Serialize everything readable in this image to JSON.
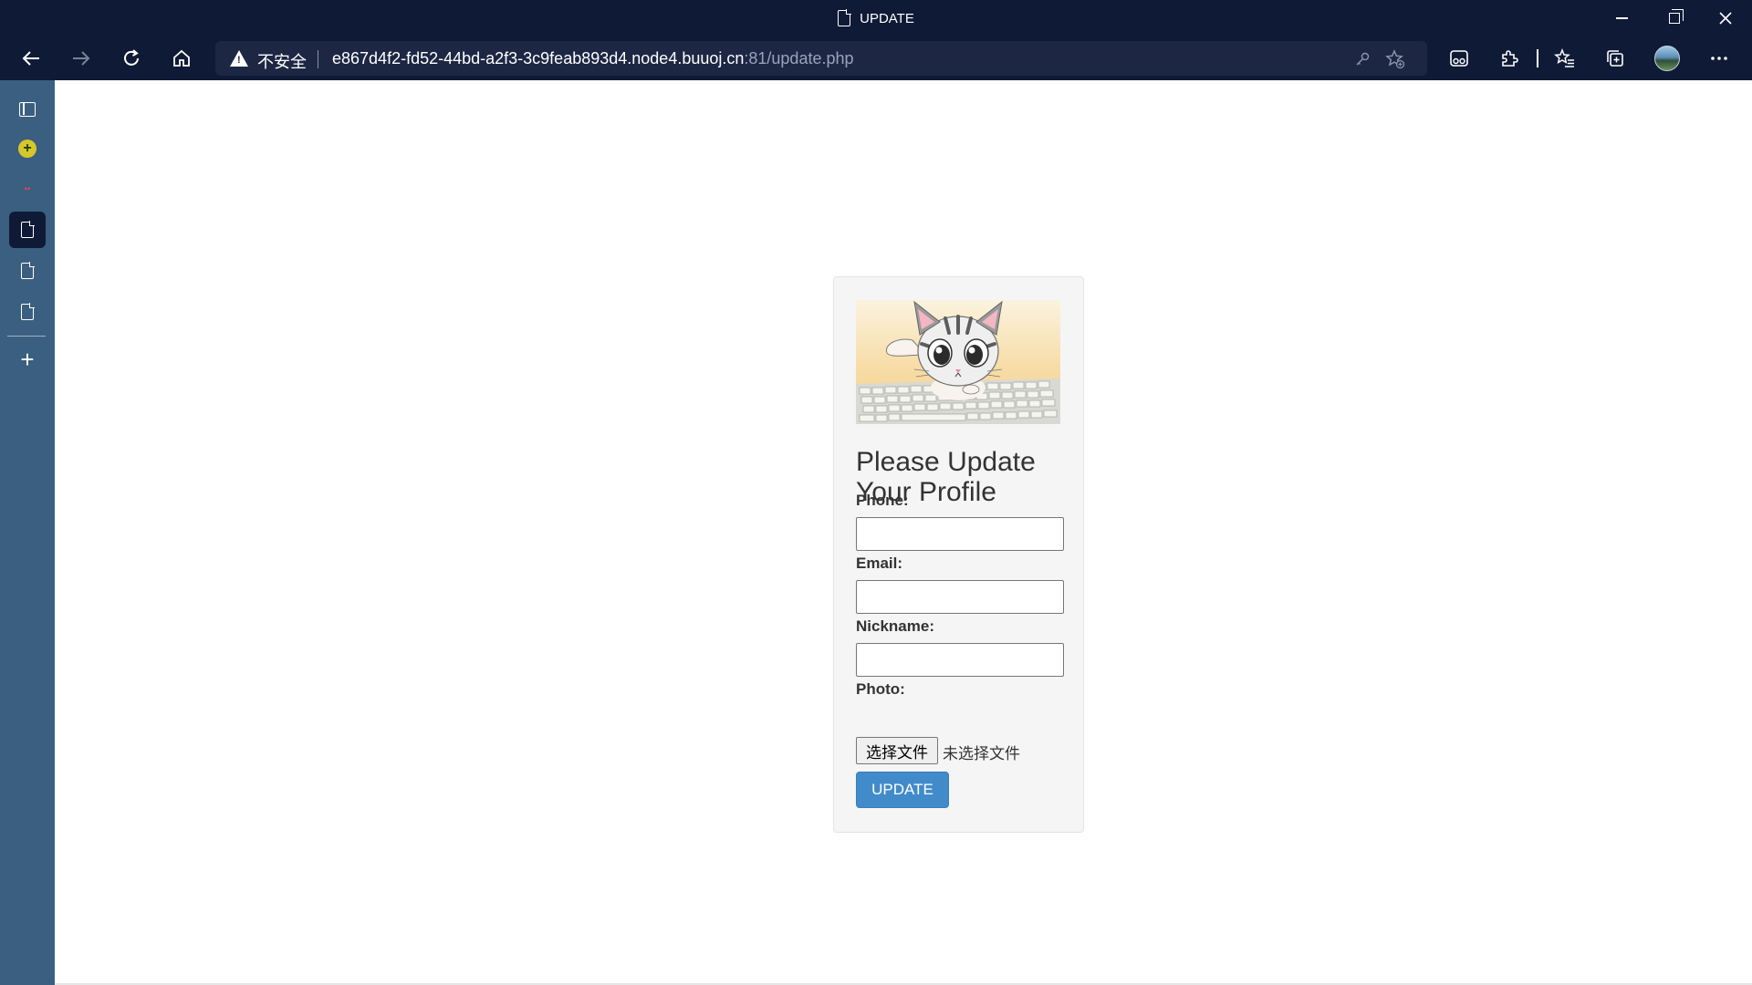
{
  "window": {
    "title": "UPDATE"
  },
  "toolbar": {
    "security_label": "不安全",
    "url_host": "e867d4f2-fd52-44bd-a2f3-3c9feab893d4.node4.buuoj.cn",
    "url_path": ":81/update.php",
    "icons": [
      "back-icon",
      "forward-icon",
      "refresh-icon",
      "home-icon",
      "key-icon",
      "add-favorite-icon",
      "immersive-reader-icon",
      "extensions-icon",
      "favorites-icon",
      "collections-icon",
      "profile-avatar",
      "more-icon"
    ]
  },
  "sidebar": {
    "items": [
      "tab-actions-icon",
      "extension-badge-icon",
      "red-tab-icon",
      "page-tab-active",
      "page-tab",
      "page-tab",
      "new-tab-icon"
    ]
  },
  "form": {
    "heading": "Please Update Your Profile",
    "phone_label": "Phone:",
    "email_label": "Email:",
    "nickname_label": "Nickname:",
    "photo_label": "Photo:",
    "phone_value": "",
    "email_value": "",
    "nickname_value": "",
    "file_button_label": "选择文件",
    "file_status": "未选择文件",
    "submit_label": "UPDATE"
  },
  "colors": {
    "chrome_bg": "#0f1a36",
    "sidebar_bg": "#3b5f80",
    "button_primary": "#428bca",
    "card_bg": "#f5f5f5"
  }
}
